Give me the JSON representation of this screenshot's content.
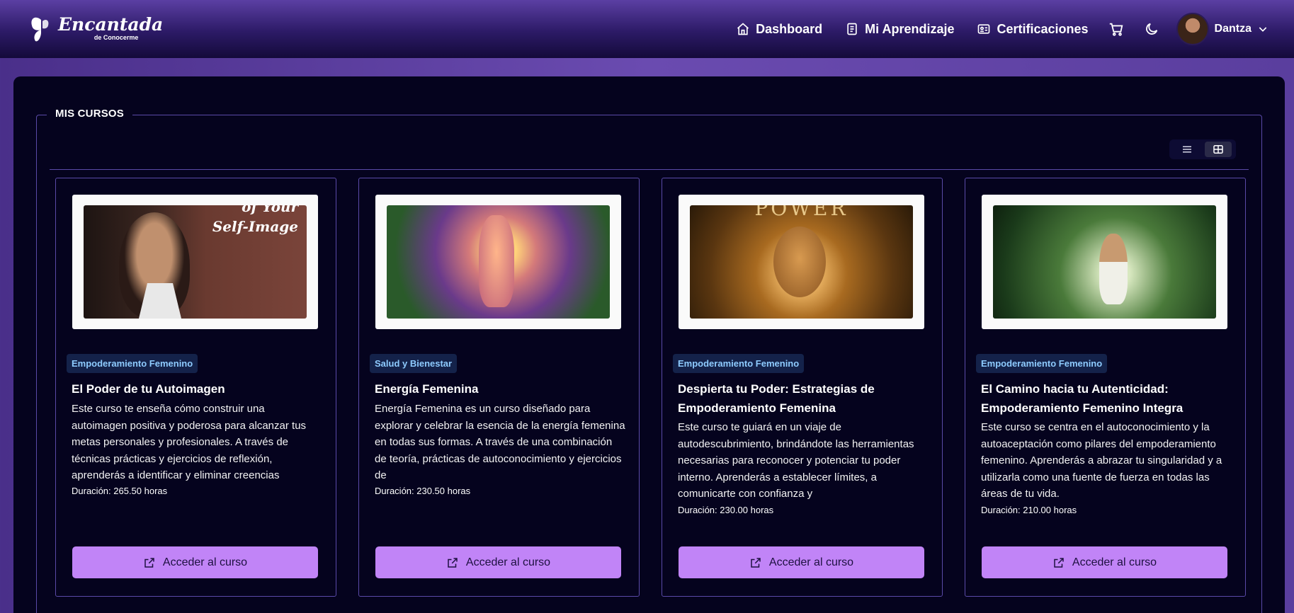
{
  "brand": {
    "logo_text": "Encantada",
    "logo_subtext": "de Conocerme"
  },
  "nav": {
    "items": [
      {
        "label": "Dashboard",
        "icon": "home-icon"
      },
      {
        "label": "Mi Aprendizaje",
        "icon": "notebook-icon"
      },
      {
        "label": "Certificaciones",
        "icon": "id-card-icon"
      }
    ],
    "cart_icon": "cart-icon",
    "theme_icon": "moon-icon",
    "user": {
      "name": "Dantza"
    }
  },
  "section": {
    "legend": "MIS CURSOS"
  },
  "view_toggle": {
    "options": [
      "list-view",
      "grid-view"
    ],
    "active": "grid-view"
  },
  "courses": [
    {
      "category": "Empoderamiento Femenino",
      "title": "El Poder de tu Autoimagen",
      "thumb_text": "of Your Self-Image",
      "description": "Este curso te enseña cómo construir una autoimagen positiva y poderosa para alcanzar tus metas personales y profesionales. A través de técnicas prácticas y ejercicios de reflexión, aprenderás a identificar y eliminar creencias",
      "duration": "Duración: 265.50 horas",
      "button": "Acceder al curso"
    },
    {
      "category": "Salud y Bienestar",
      "title": "Energía Femenina",
      "thumb_text": "",
      "description": "Energía Femenina es un curso diseñado para explorar y celebrar la esencia de la energía femenina en todas sus formas. A través de una combinación de teoría, prácticas de autoconocimiento y ejercicios de",
      "duration": "Duración: 230.50 horas",
      "button": "Acceder al curso"
    },
    {
      "category": "Empoderamiento Femenino",
      "title": "Despierta tu Poder: Estrategias de Empoderamiento Femenina",
      "thumb_text": "POWER",
      "description": "Este curso te guiará en un viaje de autodescubrimiento, brindándote las herramientas necesarias para reconocer y potenciar tu poder interno. Aprenderás a establecer límites, a comunicarte con confianza y",
      "duration": "Duración: 230.00 horas",
      "button": "Acceder al curso"
    },
    {
      "category": "Empoderamiento Femenino",
      "title": "El Camino hacia tu Autenticidad: Empoderamiento Femenino Integra",
      "thumb_text": "",
      "description": "Este curso se centra en el autoconocimiento y la autoaceptación como pilares del empoderamiento femenino. Aprenderás a abrazar tu singularidad y a utilizarla como una fuente de fuerza en todas las áreas de tu vida.",
      "duration": "Duración: 210.00 horas",
      "button": "Acceder al curso"
    }
  ],
  "colors": {
    "accent_button": "#c184f7",
    "badge_text": "#8ecbff",
    "panel_bg": "#05031e",
    "border": "#5a4aa8"
  }
}
